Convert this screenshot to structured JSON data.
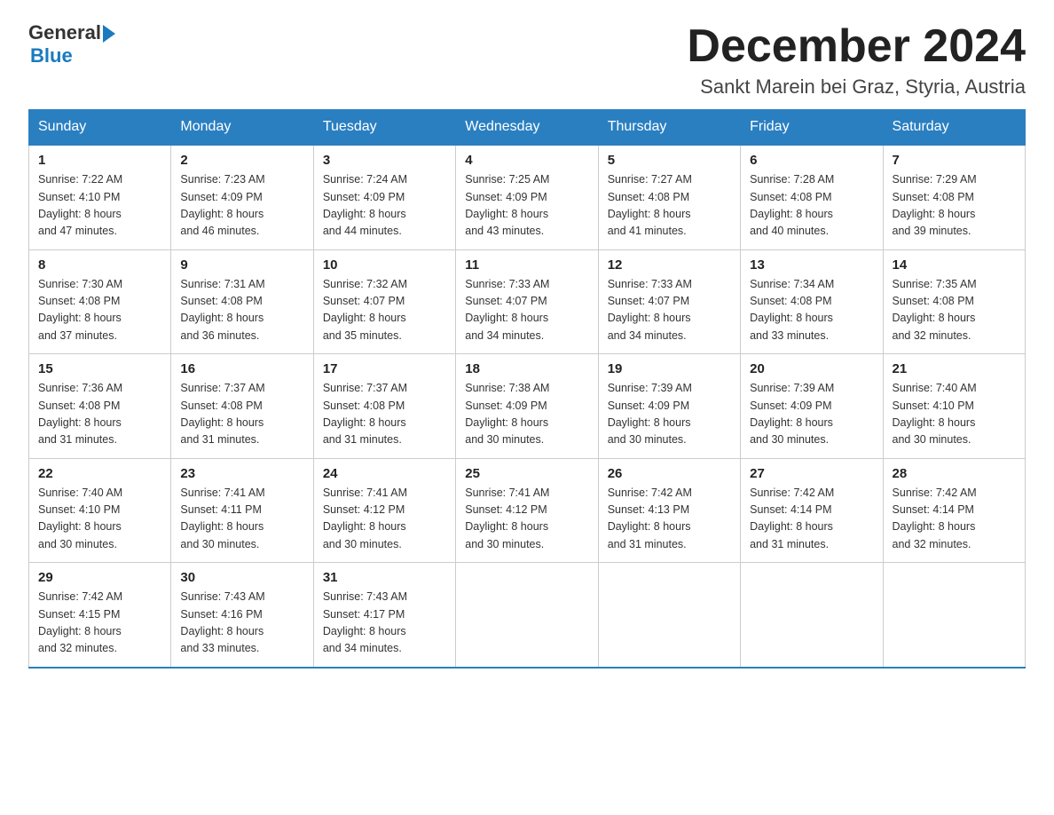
{
  "header": {
    "logo_general": "General",
    "logo_blue": "Blue",
    "month_title": "December 2024",
    "subtitle": "Sankt Marein bei Graz, Styria, Austria"
  },
  "days_of_week": [
    "Sunday",
    "Monday",
    "Tuesday",
    "Wednesday",
    "Thursday",
    "Friday",
    "Saturday"
  ],
  "weeks": [
    [
      {
        "day": "1",
        "sunrise": "7:22 AM",
        "sunset": "4:10 PM",
        "daylight": "8 hours and 47 minutes."
      },
      {
        "day": "2",
        "sunrise": "7:23 AM",
        "sunset": "4:09 PM",
        "daylight": "8 hours and 46 minutes."
      },
      {
        "day": "3",
        "sunrise": "7:24 AM",
        "sunset": "4:09 PM",
        "daylight": "8 hours and 44 minutes."
      },
      {
        "day": "4",
        "sunrise": "7:25 AM",
        "sunset": "4:09 PM",
        "daylight": "8 hours and 43 minutes."
      },
      {
        "day": "5",
        "sunrise": "7:27 AM",
        "sunset": "4:08 PM",
        "daylight": "8 hours and 41 minutes."
      },
      {
        "day": "6",
        "sunrise": "7:28 AM",
        "sunset": "4:08 PM",
        "daylight": "8 hours and 40 minutes."
      },
      {
        "day": "7",
        "sunrise": "7:29 AM",
        "sunset": "4:08 PM",
        "daylight": "8 hours and 39 minutes."
      }
    ],
    [
      {
        "day": "8",
        "sunrise": "7:30 AM",
        "sunset": "4:08 PM",
        "daylight": "8 hours and 37 minutes."
      },
      {
        "day": "9",
        "sunrise": "7:31 AM",
        "sunset": "4:08 PM",
        "daylight": "8 hours and 36 minutes."
      },
      {
        "day": "10",
        "sunrise": "7:32 AM",
        "sunset": "4:07 PM",
        "daylight": "8 hours and 35 minutes."
      },
      {
        "day": "11",
        "sunrise": "7:33 AM",
        "sunset": "4:07 PM",
        "daylight": "8 hours and 34 minutes."
      },
      {
        "day": "12",
        "sunrise": "7:33 AM",
        "sunset": "4:07 PM",
        "daylight": "8 hours and 34 minutes."
      },
      {
        "day": "13",
        "sunrise": "7:34 AM",
        "sunset": "4:08 PM",
        "daylight": "8 hours and 33 minutes."
      },
      {
        "day": "14",
        "sunrise": "7:35 AM",
        "sunset": "4:08 PM",
        "daylight": "8 hours and 32 minutes."
      }
    ],
    [
      {
        "day": "15",
        "sunrise": "7:36 AM",
        "sunset": "4:08 PM",
        "daylight": "8 hours and 31 minutes."
      },
      {
        "day": "16",
        "sunrise": "7:37 AM",
        "sunset": "4:08 PM",
        "daylight": "8 hours and 31 minutes."
      },
      {
        "day": "17",
        "sunrise": "7:37 AM",
        "sunset": "4:08 PM",
        "daylight": "8 hours and 31 minutes."
      },
      {
        "day": "18",
        "sunrise": "7:38 AM",
        "sunset": "4:09 PM",
        "daylight": "8 hours and 30 minutes."
      },
      {
        "day": "19",
        "sunrise": "7:39 AM",
        "sunset": "4:09 PM",
        "daylight": "8 hours and 30 minutes."
      },
      {
        "day": "20",
        "sunrise": "7:39 AM",
        "sunset": "4:09 PM",
        "daylight": "8 hours and 30 minutes."
      },
      {
        "day": "21",
        "sunrise": "7:40 AM",
        "sunset": "4:10 PM",
        "daylight": "8 hours and 30 minutes."
      }
    ],
    [
      {
        "day": "22",
        "sunrise": "7:40 AM",
        "sunset": "4:10 PM",
        "daylight": "8 hours and 30 minutes."
      },
      {
        "day": "23",
        "sunrise": "7:41 AM",
        "sunset": "4:11 PM",
        "daylight": "8 hours and 30 minutes."
      },
      {
        "day": "24",
        "sunrise": "7:41 AM",
        "sunset": "4:12 PM",
        "daylight": "8 hours and 30 minutes."
      },
      {
        "day": "25",
        "sunrise": "7:41 AM",
        "sunset": "4:12 PM",
        "daylight": "8 hours and 30 minutes."
      },
      {
        "day": "26",
        "sunrise": "7:42 AM",
        "sunset": "4:13 PM",
        "daylight": "8 hours and 31 minutes."
      },
      {
        "day": "27",
        "sunrise": "7:42 AM",
        "sunset": "4:14 PM",
        "daylight": "8 hours and 31 minutes."
      },
      {
        "day": "28",
        "sunrise": "7:42 AM",
        "sunset": "4:14 PM",
        "daylight": "8 hours and 32 minutes."
      }
    ],
    [
      {
        "day": "29",
        "sunrise": "7:42 AM",
        "sunset": "4:15 PM",
        "daylight": "8 hours and 32 minutes."
      },
      {
        "day": "30",
        "sunrise": "7:43 AM",
        "sunset": "4:16 PM",
        "daylight": "8 hours and 33 minutes."
      },
      {
        "day": "31",
        "sunrise": "7:43 AM",
        "sunset": "4:17 PM",
        "daylight": "8 hours and 34 minutes."
      },
      null,
      null,
      null,
      null
    ]
  ],
  "labels": {
    "sunrise": "Sunrise:",
    "sunset": "Sunset:",
    "daylight": "Daylight:"
  }
}
